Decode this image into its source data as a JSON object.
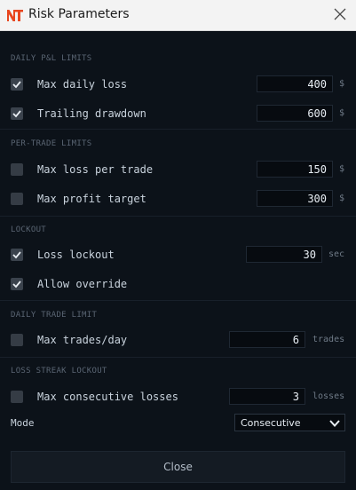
{
  "window": {
    "title": "Risk Parameters"
  },
  "sections": {
    "daily": "DAILY P&L LIMITS",
    "per_trade": "PER-TRADE LIMITS",
    "lockout": "LOCKOUT",
    "daily_trade": "DAILY TRADE LIMIT",
    "loss_streak": "LOSS STREAK LOCKOUT"
  },
  "rows": {
    "max_daily_loss": {
      "label": "Max daily loss",
      "checked": true,
      "value": "400",
      "unit": "$"
    },
    "trailing_drawdown": {
      "label": "Trailing drawdown",
      "checked": true,
      "value": "600",
      "unit": "$"
    },
    "max_loss_per_trade": {
      "label": "Max loss per trade",
      "checked": false,
      "value": "150",
      "unit": "$"
    },
    "max_profit_target": {
      "label": "Max profit target",
      "checked": false,
      "value": "300",
      "unit": "$"
    },
    "loss_lockout": {
      "label": "Loss lockout",
      "checked": true,
      "value": "30",
      "unit": "sec"
    },
    "allow_override": {
      "label": "Allow override",
      "checked": true
    },
    "max_trades_day": {
      "label": "Max trades/day",
      "checked": false,
      "value": "6",
      "unit": "trades"
    },
    "max_consecutive_losses": {
      "label": "Max consecutive losses",
      "checked": false,
      "value": "3",
      "unit": "losses"
    }
  },
  "mode": {
    "label": "Mode",
    "value": "Consecutive"
  },
  "close_button": {
    "label": "Close"
  },
  "icons": {
    "logo": "nt-logo-icon",
    "close": "close-icon",
    "check": "check-icon",
    "chevron": "chevron-down-icon"
  },
  "colors": {
    "accent": "#e8461f",
    "background": "#0c1219",
    "titlebar": "#f3f3f3"
  }
}
